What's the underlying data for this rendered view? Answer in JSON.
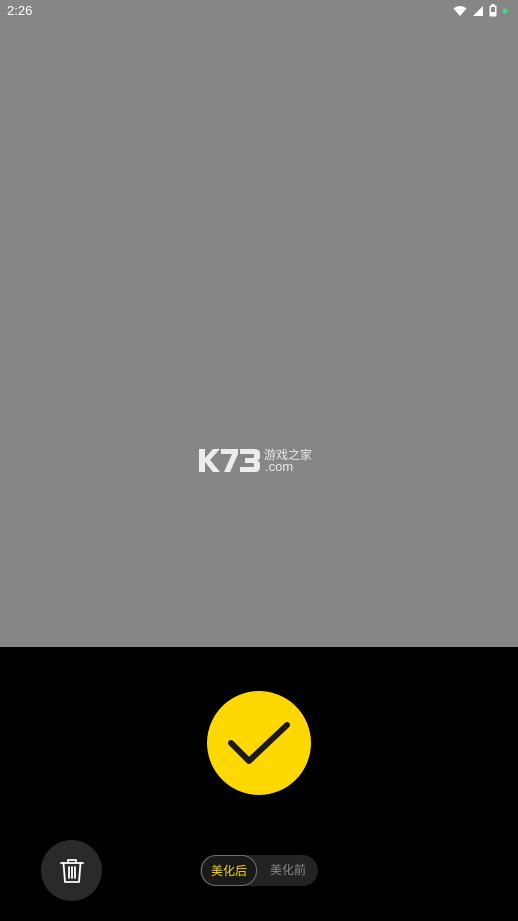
{
  "status_bar": {
    "time": "2:26"
  },
  "preview": {
    "watermark": {
      "logo_text": "K73",
      "chinese_text": "游戏之家",
      "domain_text": ".com"
    }
  },
  "controls": {
    "confirm_icon": "checkmark-icon",
    "delete_icon": "trash-icon",
    "toggle": {
      "after_label": "美化后",
      "before_label": "美化前",
      "selected": "after_label"
    }
  },
  "colors": {
    "accent": "#fed800",
    "preview_bg": "#868686",
    "panel_bg": "#000000"
  }
}
